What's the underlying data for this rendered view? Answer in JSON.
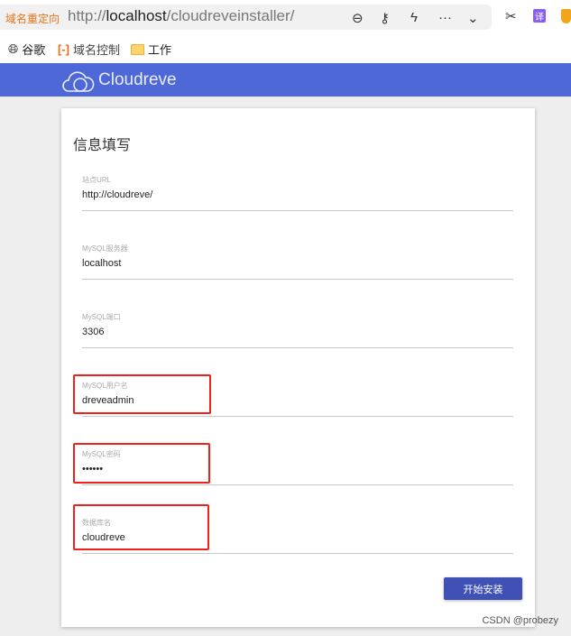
{
  "browser": {
    "redirect_label": "域名重定向",
    "url_prefix": "http://",
    "url_host": "localhost",
    "url_path": "/cloudreveinstaller/",
    "translate_label": "译"
  },
  "bookmarks": [
    {
      "label": "谷歌",
      "icon": "globe-icon"
    },
    {
      "label": "域名控制",
      "icon": "aliyun-icon"
    },
    {
      "label": "工作",
      "icon": "folder-icon"
    }
  ],
  "header": {
    "brand": "Cloudreve",
    "color": "#4f68d8"
  },
  "form": {
    "title": "信息填写",
    "fields": [
      {
        "label": "站点URL",
        "value": "http://cloudreve/"
      },
      {
        "label": "MySQL服务器",
        "value": "localhost"
      },
      {
        "label": "MySQL端口",
        "value": "3306"
      },
      {
        "label": "MySQL用户名",
        "value": "dreveadmin"
      },
      {
        "label": "MySQL密码",
        "value": "••••••"
      },
      {
        "label": "数据库名",
        "value": "cloudreve"
      }
    ],
    "submit_label": "开始安装"
  },
  "watermark": "CSDN @probezy"
}
